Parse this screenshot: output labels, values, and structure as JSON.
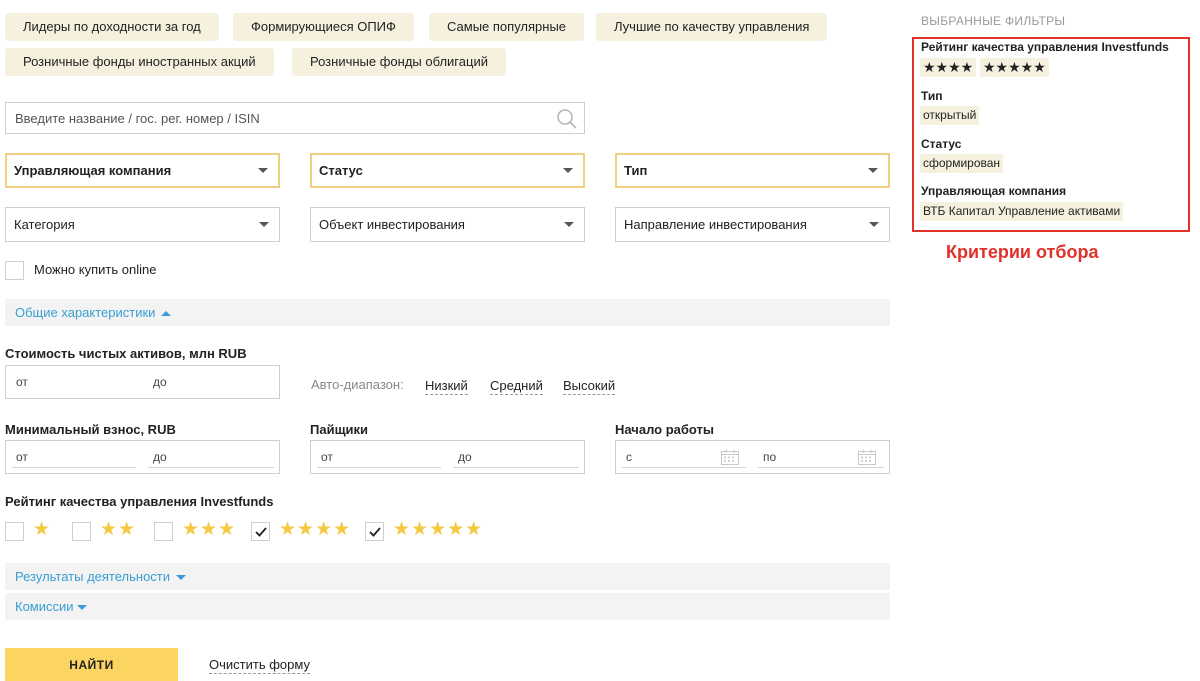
{
  "presets": [
    "Лидеры по доходности за год",
    "Формирующиеся ОПИФ",
    "Самые популярные",
    "Лучшие по качеству управления",
    "Розничные фонды иностранных акций",
    "Розничные фонды облигаций"
  ],
  "search": {
    "placeholder": "Введите название / гос. рег. номер / ISIN",
    "icon": "search-icon"
  },
  "dropdowns_primary": [
    {
      "label": "Управляющая компания"
    },
    {
      "label": "Статус"
    },
    {
      "label": "Тип"
    }
  ],
  "dropdowns_secondary": [
    {
      "label": "Категория"
    },
    {
      "label": "Объект инвестирования"
    },
    {
      "label": "Направление инвестирования"
    }
  ],
  "online": {
    "label": "Можно купить online",
    "checked": false
  },
  "sections": {
    "general": "Общие характеристики",
    "results": "Результаты деятельности",
    "commissions": "Комиссии"
  },
  "net_assets": {
    "label": "Стоимость чистых активов, млн RUB",
    "from": "от",
    "to": "до",
    "auto_label": "Авто-диапазон:",
    "auto_options": [
      "Низкий",
      "Средний",
      "Высокий"
    ]
  },
  "min_payment": {
    "label": "Минимальный взнос, RUB",
    "from": "от",
    "to": "до"
  },
  "holders": {
    "label": "Пайщики",
    "from": "от",
    "to": "до"
  },
  "start": {
    "label": "Начало работы",
    "from": "с",
    "to": "по"
  },
  "rating": {
    "label": "Рейтинг качества управления Investfunds",
    "options": [
      {
        "stars": "★",
        "checked": false
      },
      {
        "stars": "★★",
        "checked": false
      },
      {
        "stars": "★★★",
        "checked": false
      },
      {
        "stars": "★★★★",
        "checked": true
      },
      {
        "stars": "★★★★★",
        "checked": true
      }
    ]
  },
  "buttons": {
    "find": "НАЙТИ",
    "clear": "Очистить форму"
  },
  "selected": {
    "title": "ВЫБРАННЫЕ ФИЛЬТРЫ",
    "rating_label": "Рейтинг качества управления Investfunds",
    "rating_values": [
      "★★★★",
      "★★★★★"
    ],
    "type_label": "Тип",
    "type_value": "открытый",
    "status_label": "Статус",
    "status_value": "сформирован",
    "company_label": "Управляющая компания",
    "company_value": "ВТБ Капитал Управление активами"
  },
  "annotation": "Критерии отбора",
  "colors": {
    "chip_bg": "#f6f1df",
    "highlight_border": "#f2cf80",
    "link": "#3a9ed3",
    "star": "#f5c842",
    "button": "#fcd462",
    "annotation": "#e0322a"
  }
}
